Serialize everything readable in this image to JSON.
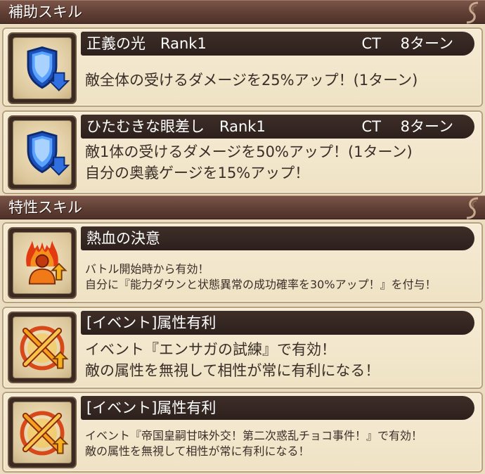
{
  "sections": {
    "support": {
      "label": "補助スキル"
    },
    "trait": {
      "label": "特性スキル"
    }
  },
  "skills": [
    {
      "icon": "shield-down-icon",
      "title": "正義の光　Rank1",
      "ct": "CT　 8ターン",
      "lines": [
        "敵全体の受けるダメージを25%アップ！(1ターン)"
      ]
    },
    {
      "icon": "shield-down-icon",
      "title": "ひたむきな眼差し　Rank1",
      "ct": "CT　 8ターン",
      "lines": [
        "敵1体の受けるダメージを50%アップ！(1ターン)",
        "自分の奥義ゲージを15%アップ！"
      ]
    }
  ],
  "traits": [
    {
      "icon": "flame-person-up-icon",
      "title": "熱血の決意",
      "lines": [
        "バトル開始時から有効！",
        "自分に『能力ダウンと状態異常の成功確率を30%アップ！』を付与！"
      ]
    },
    {
      "icon": "crossed-swords-up-icon",
      "title": "[イベント]属性有利",
      "lines": [
        "イベント『エンサガの試練』で有効！",
        "敵の属性を無視して相性が常に有利になる！"
      ]
    },
    {
      "icon": "crossed-swords-up-icon",
      "title": "[イベント]属性有利",
      "lines": [
        "イベント『帝国皇嗣甘味外交！第二次惑乱チョコ事件！』で有効！",
        "敵の属性を無視して相性が常に有利になる！"
      ]
    }
  ],
  "colors": {
    "header_bg": "#5e3d33",
    "title_bar_bg": "#2d201c",
    "card_bg": "#f6ecd6",
    "shield_blue": "#2f6fe0",
    "flame_orange": "#f07a18",
    "swords_orange": "#f5a11c"
  }
}
